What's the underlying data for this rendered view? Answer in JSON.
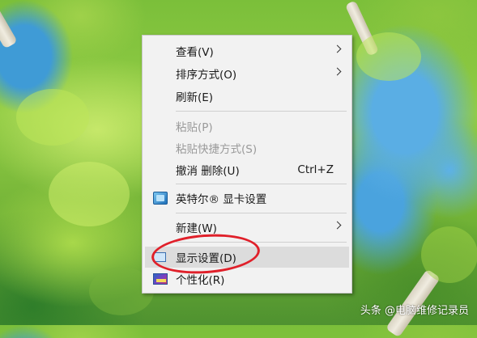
{
  "context_menu": {
    "items": [
      {
        "label": "查看(V)",
        "submenu": true
      },
      {
        "label": "排序方式(O)",
        "submenu": true
      },
      {
        "label": "刷新(E)"
      },
      {
        "label": "粘贴(P)",
        "disabled": true
      },
      {
        "label": "粘贴快捷方式(S)",
        "disabled": true
      },
      {
        "label": "撤消 删除(U)",
        "shortcut": "Ctrl+Z"
      },
      {
        "label": "英特尔® 显卡设置",
        "icon": "intel-graphics-icon"
      },
      {
        "label": "新建(W)",
        "submenu": true
      },
      {
        "label": "显示设置(D)",
        "icon": "display-settings-icon",
        "highlighted": true
      },
      {
        "label": "个性化(R)",
        "icon": "personalize-icon"
      }
    ]
  },
  "annotation": {
    "highlight_color": "#e0202a"
  },
  "watermark": {
    "text": "头条 @电脑维修记录员"
  }
}
